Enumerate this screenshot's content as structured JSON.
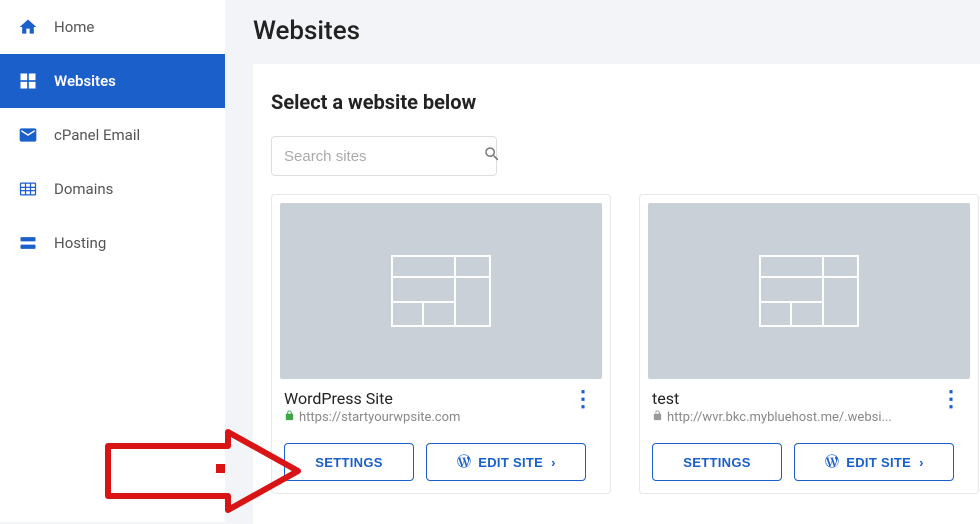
{
  "sidebar": {
    "items": [
      {
        "label": "Home"
      },
      {
        "label": "Websites"
      },
      {
        "label": "cPanel Email"
      },
      {
        "label": "Domains"
      },
      {
        "label": "Hosting"
      }
    ]
  },
  "page": {
    "title": "Websites",
    "subtitle": "Select a website below"
  },
  "search": {
    "placeholder": "Search sites"
  },
  "cards": [
    {
      "name": "WordPress Site",
      "url": "https://startyourwpsite.com",
      "settings_label": "SETTINGS",
      "edit_label": "EDIT SITE",
      "secure": true
    },
    {
      "name": "test",
      "url": "http://wvr.bkc.mybluehost.me/.websi...",
      "settings_label": "SETTINGS",
      "edit_label": "EDIT SITE",
      "secure": false
    }
  ],
  "colors": {
    "accent": "#1b5fca",
    "arrow": "#d91414"
  }
}
